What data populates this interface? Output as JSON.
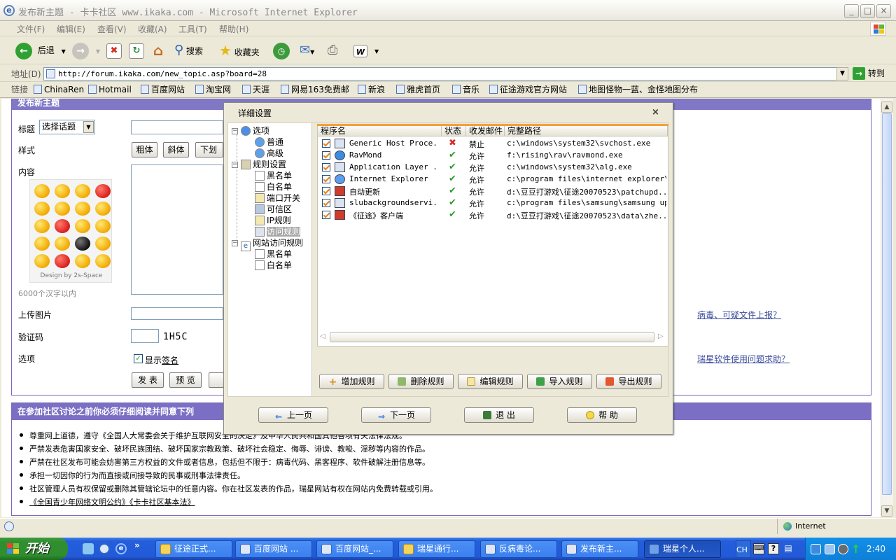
{
  "window": {
    "title": "发布新主题 - 卡卡社区 www.ikaka.com - Microsoft Internet Explorer",
    "minimize": "_",
    "maximize": "□",
    "close": "×"
  },
  "menu": [
    "文件(F)",
    "编辑(E)",
    "查看(V)",
    "收藏(A)",
    "工具(T)",
    "帮助(H)"
  ],
  "toolbar": {
    "back": "后退",
    "search": "搜索",
    "favorites": "收藏夹"
  },
  "address": {
    "label": "地址(D)",
    "value": "http://forum.ikaka.com/new_topic.asp?board=28",
    "go": "转到"
  },
  "links": {
    "label": "链接",
    "items": [
      "ChinaRen",
      "Hotmail",
      "百度网站",
      "淘宝网",
      "天涯",
      "网易163免费邮",
      "新浪",
      "雅虎首页",
      "音乐",
      "征途游戏官方网站",
      "地图怪物一蓝、金怪地图分布"
    ]
  },
  "form": {
    "header": "发布新主题",
    "title_label": "标题",
    "topic_select": "选择话题",
    "style_label": "样式",
    "bold": "粗体",
    "italic": "斜体",
    "underline": "下划线",
    "content_label": "内容",
    "emoji_credit": "Design by 2s-Space",
    "limit_note": "6000个汉字以内",
    "upload_label": "上传图片",
    "captcha_label": "验证码",
    "captcha_value": "1H5C",
    "options_label": "选项",
    "show_sign_prefix": "显示",
    "show_sign_link": "签名",
    "publish": "发 表",
    "preview": "预 览",
    "side_link_1": "病毒、可疑文件上报？",
    "side_link_2": "瑞星软件使用问题求助？"
  },
  "notice": {
    "header": "在参加社区讨论之前你必须仔细阅读并同意下列",
    "rules": [
      "尊重网上道德，遵守《全国人大常委会关于维护互联网安全的决定》及中华人民共和国其他各项有关法律法规。",
      "严禁发表危害国家安全、破坏民族团结、破坏国家宗教政策、破坏社会稳定、侮辱、诽谤、教唆、淫秽等内容的作品。",
      "严禁在社区发布可能会妨害第三方权益的文件或者信息，包括但不限于：病毒代码、黑客程序、软件破解注册信息等。",
      "承担一切因你的行为而直接或间接导致的民事或刑事法律责任。",
      "社区管理人员有权保留或删除其管辖论坛中的任意内容。你在社区发表的作品，瑞星网站有权在网站内免费转载或引用。",
      "《全国青少年网络文明公约》《卡卡社区基本法》"
    ]
  },
  "status": {
    "zone": "Internet"
  },
  "dialog": {
    "title": "详细设置",
    "close": "×",
    "tree": {
      "options": "选项",
      "normal": "普通",
      "advanced": "高级",
      "rules": "规则设置",
      "blacklist": "黑名单",
      "whitelist": "白名单",
      "port_switch": "端口开关",
      "trusted": "可信区",
      "ip_rules": "IP规则",
      "access_rules": "访问规则",
      "web_access": "网站访问规则",
      "web_blacklist": "黑名单",
      "web_whitelist": "白名单"
    },
    "columns": [
      "程序名",
      "状态",
      "收发邮件",
      "完整路径"
    ],
    "rows": [
      {
        "name": "Generic Host Proce...",
        "status": "deny",
        "mail": "禁止",
        "path": "c:\\windows\\system32\\svchost.exe"
      },
      {
        "name": "RavMond",
        "status": "allow",
        "mail": "允许",
        "path": "f:\\rising\\rav\\ravmond.exe"
      },
      {
        "name": "Application Layer ...",
        "status": "allow",
        "mail": "允许",
        "path": "c:\\windows\\system32\\alg.exe"
      },
      {
        "name": "Internet Explorer",
        "status": "allow",
        "mail": "允许",
        "path": "c:\\program files\\internet explorer\\..."
      },
      {
        "name": "自动更新",
        "status": "allow",
        "mail": "允许",
        "path": "d:\\豆豆打游戏\\征途20070523\\patchupd..."
      },
      {
        "name": "slubackgroundservi...",
        "status": "allow",
        "mail": "允许",
        "path": "c:\\program files\\samsung\\samsung up..."
      },
      {
        "name": "《征途》客户端",
        "status": "allow",
        "mail": "允许",
        "path": "d:\\豆豆打游戏\\征途20070523\\data\\zhe..."
      }
    ],
    "buttons": [
      "增加规则",
      "删除规则",
      "编辑规则",
      "导入规则",
      "导出规则"
    ],
    "nav": {
      "prev": "上一页",
      "next": "下一页",
      "exit": "退 出",
      "help": "帮 助"
    }
  },
  "taskbar": {
    "start": "开始",
    "tasks": [
      "征途正式...",
      "百度网站 ...",
      "百度网站_...",
      "瑞星通行...",
      "反病毒论...",
      "发布新主...",
      "瑞星个人..."
    ],
    "ime": "CH",
    "time": "2:40"
  }
}
